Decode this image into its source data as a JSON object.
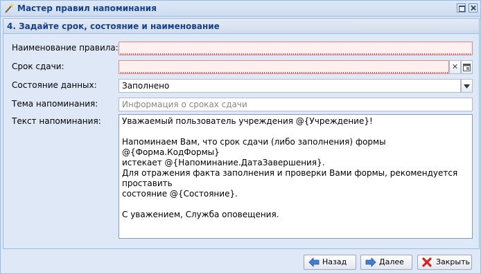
{
  "window": {
    "title": "Мастер правил напоминания"
  },
  "step": {
    "title": "4. Задайте срок, состояние и наименование"
  },
  "form": {
    "rule_name_label": "Наименование правила:",
    "rule_name_value": "",
    "deadline_label": "Срок сдачи:",
    "deadline_value": "",
    "state_label": "Состояние данных:",
    "state_value": "Заполнено",
    "subject_label": "Тема напоминания:",
    "subject_placeholder": "Информация о сроках сдачи",
    "text_label": "Текст напоминания:",
    "text_value": "Уважаемый пользователь учреждения @{Учреждение}!\n\nНапоминаем Вам, что срок сдачи (либо заполнения) формы @{Форма.КодФормы}\nистекает @{Напоминание.ДатаЗавершения}.\nДля отражения факта заполнения и проверки Вами формы, рекомендуется проставить\nсостояние @{Состояние}.\n\nС уважением, Служба оповещения."
  },
  "buttons": {
    "back": "Назад",
    "next": "Далее",
    "close": "Закрыть"
  },
  "icons": {
    "window": "wand-icon",
    "clear": "clear-x-icon",
    "picker": "select-window-icon",
    "dropdown": "chevron-down-icon",
    "back": "arrow-left-icon",
    "next": "arrow-right-icon",
    "close": "red-x-icon"
  }
}
